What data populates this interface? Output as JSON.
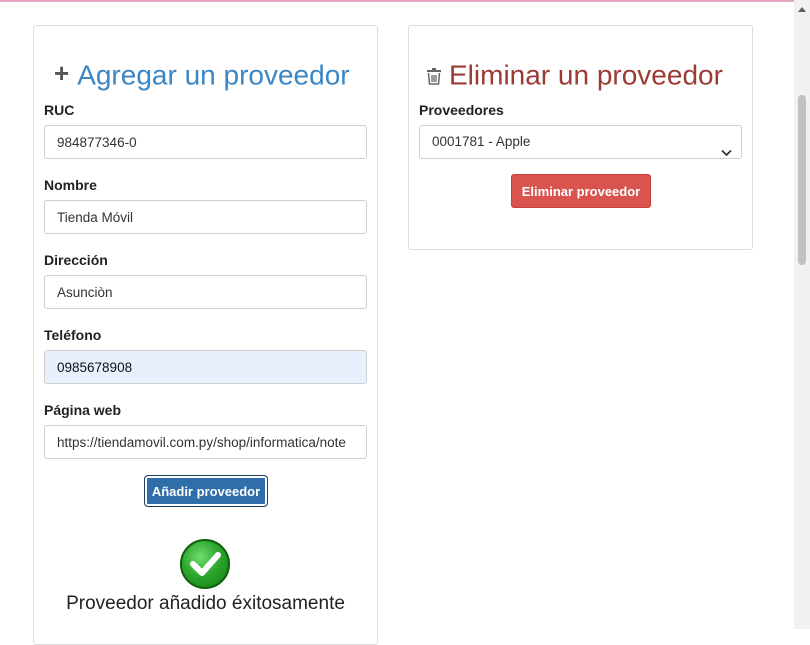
{
  "add_panel": {
    "title": "Agregar un proveedor",
    "icon": "plus-icon",
    "fields": {
      "ruc": {
        "label": "RUC",
        "value": "984877346-0"
      },
      "nombre": {
        "label": "Nombre",
        "value": "Tienda Móvil"
      },
      "direccion": {
        "label": "Dirección",
        "value": "Asunciòn"
      },
      "telefono": {
        "label": "Teléfono",
        "value": "0985678908"
      },
      "pagina_web": {
        "label": "Página web",
        "value": "https://tiendamovil.com.py/shop/informatica/note"
      }
    },
    "submit_label": "Añadir proveedor",
    "success_message": "Proveedor añadido éxitosamente",
    "success_icon": "checkmark-icon"
  },
  "delete_panel": {
    "title": "Eliminar un proveedor",
    "icon": "trash-icon",
    "select_label": "Proveedores",
    "selected_option": "0001781 - Apple",
    "delete_label": "Eliminar proveedor"
  },
  "colors": {
    "add_title": "#3b86c4",
    "delete_title": "#9b3b34",
    "primary_button": "#2f6ea8",
    "danger_button": "#d9534f",
    "success": "#2ea82e"
  }
}
